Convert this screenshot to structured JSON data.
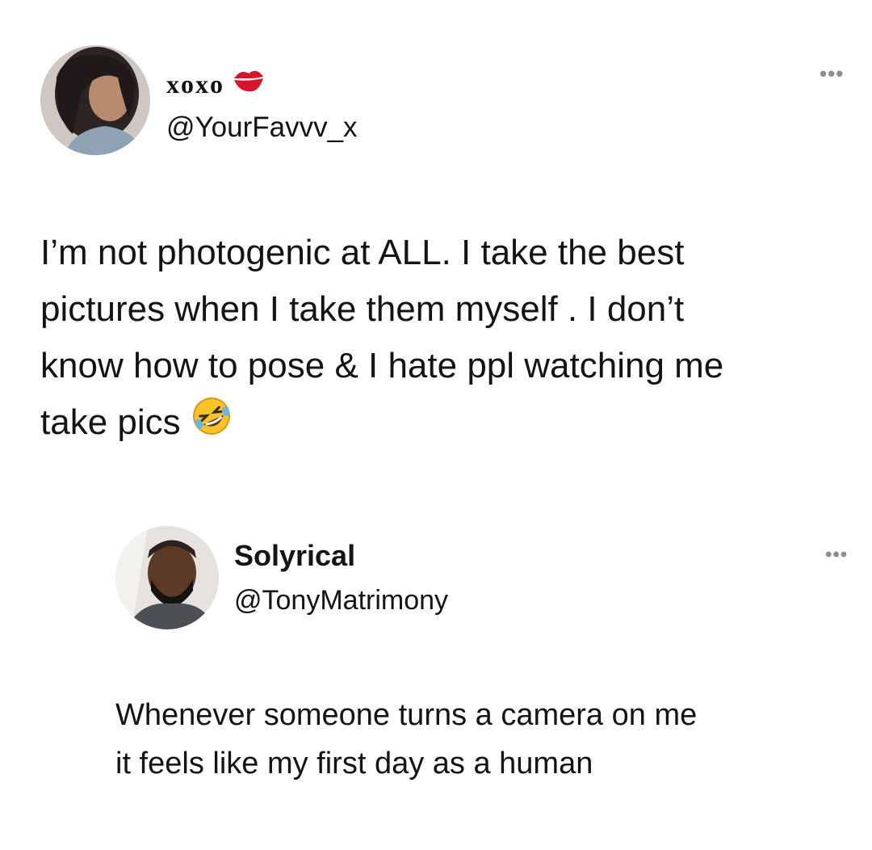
{
  "tweet": {
    "display_name": "xoxo",
    "name_icon": "kiss-mark-icon",
    "handle": "@YourFavvv_x",
    "more_icon": "more-options-icon",
    "text": "I’m not photogenic at ALL. I take the best\npictures when I take them myself . I don’t\nknow how to pose & I hate ppl watching me\ntake pics",
    "emoji": "rolling-on-floor-laughing-emoji",
    "colors": {
      "kiss": "#d8142a",
      "emoji_face": "#f7c22c"
    }
  },
  "reply": {
    "display_name": "Solyrical",
    "handle": "@TonyMatrimony",
    "more_icon": "more-options-icon",
    "text": "Whenever someone turns a camera on me\nit feels like my first day as a human"
  }
}
